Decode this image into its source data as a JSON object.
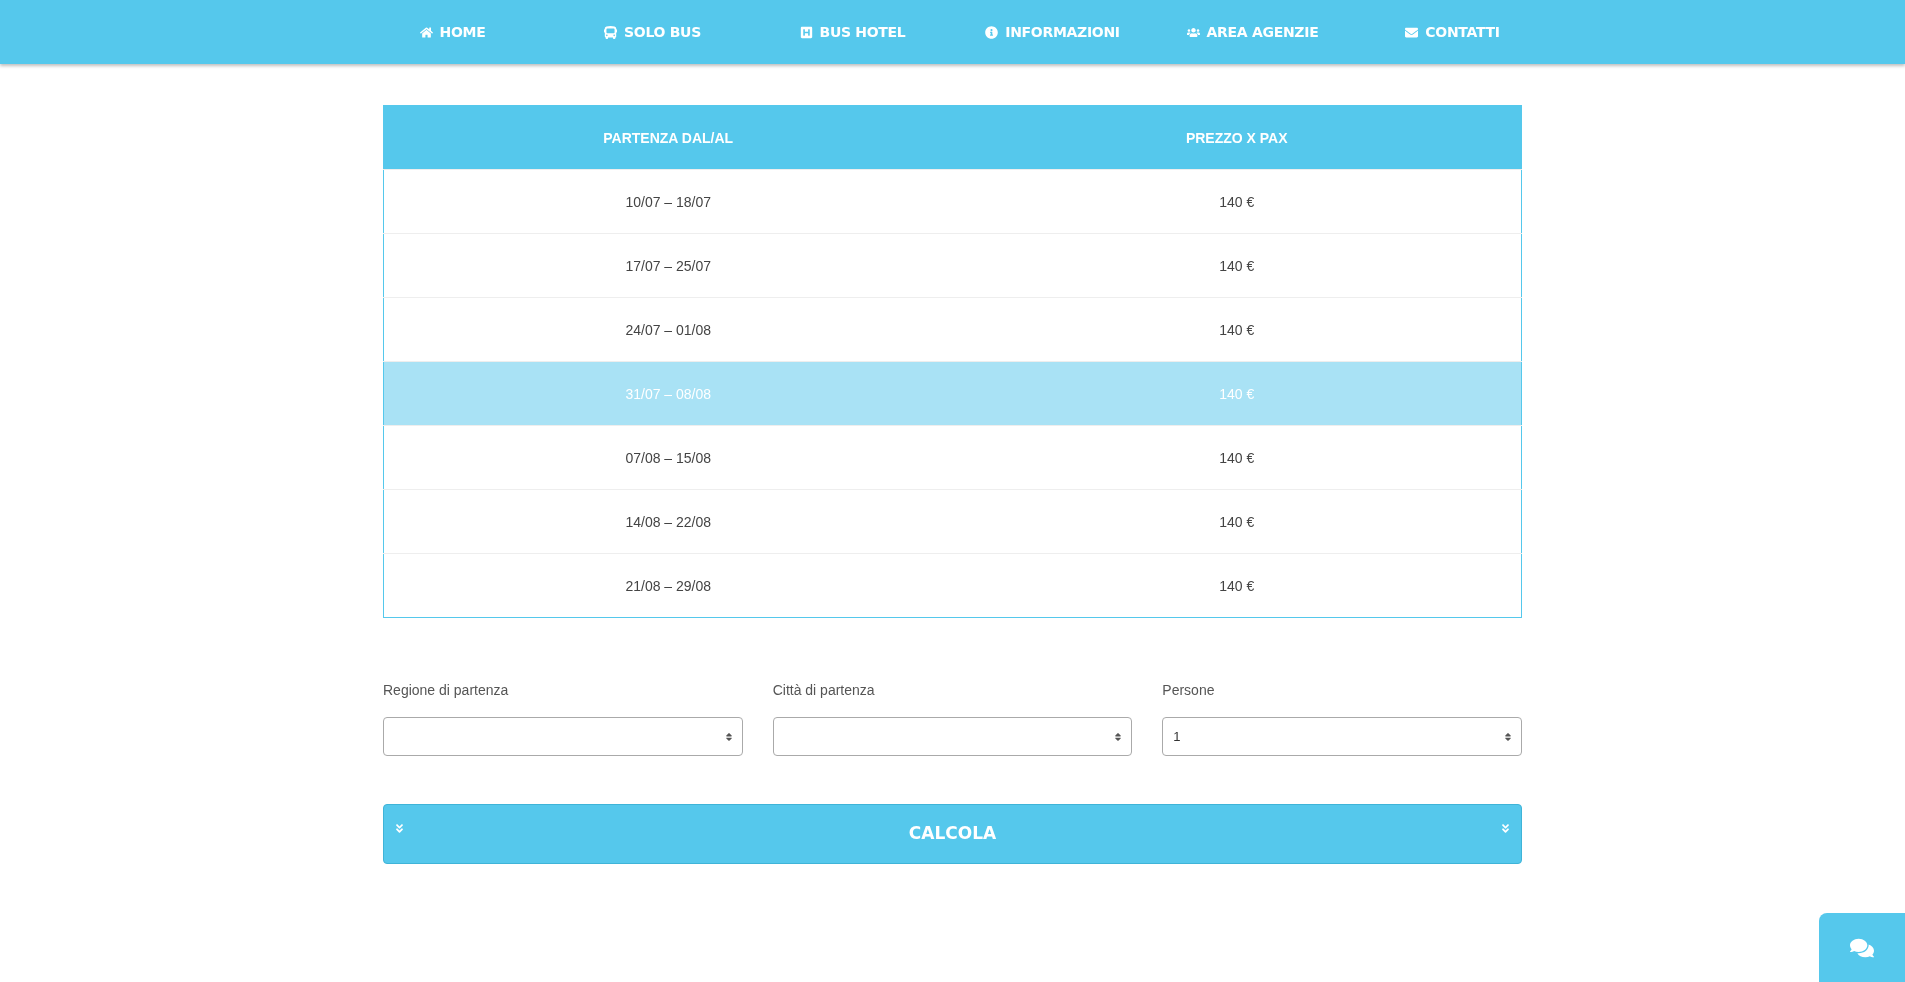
{
  "nav": [
    {
      "label": "HOME"
    },
    {
      "label": "SOLO BUS"
    },
    {
      "label": "BUS HOTEL"
    },
    {
      "label": "INFORMAZIONI"
    },
    {
      "label": "AREA AGENZIE"
    },
    {
      "label": "CONTATTI"
    }
  ],
  "table": {
    "columns": [
      "PARTENZA DAL/AL",
      "PREZZO X PAX"
    ],
    "rows": [
      {
        "cells": [
          "10/07 – 18/07",
          "140 €"
        ],
        "selected": false
      },
      {
        "cells": [
          "17/07 – 25/07",
          "140 €"
        ],
        "selected": false
      },
      {
        "cells": [
          "24/07 – 01/08",
          "140 €"
        ],
        "selected": false
      },
      {
        "cells": [
          "31/07 – 08/08",
          "140 €"
        ],
        "selected": true
      },
      {
        "cells": [
          "07/08 – 15/08",
          "140 €"
        ],
        "selected": false
      },
      {
        "cells": [
          "14/08 – 22/08",
          "140 €"
        ],
        "selected": false
      },
      {
        "cells": [
          "21/08 – 29/08",
          "140 €"
        ],
        "selected": false
      }
    ]
  },
  "form": {
    "fields": [
      {
        "label": "Regione di partenza"
      },
      {
        "label": "Città di partenza"
      },
      {
        "label": "Persone",
        "value": "1"
      }
    ]
  },
  "calculate_button": {
    "label": "CALCOLA"
  }
}
